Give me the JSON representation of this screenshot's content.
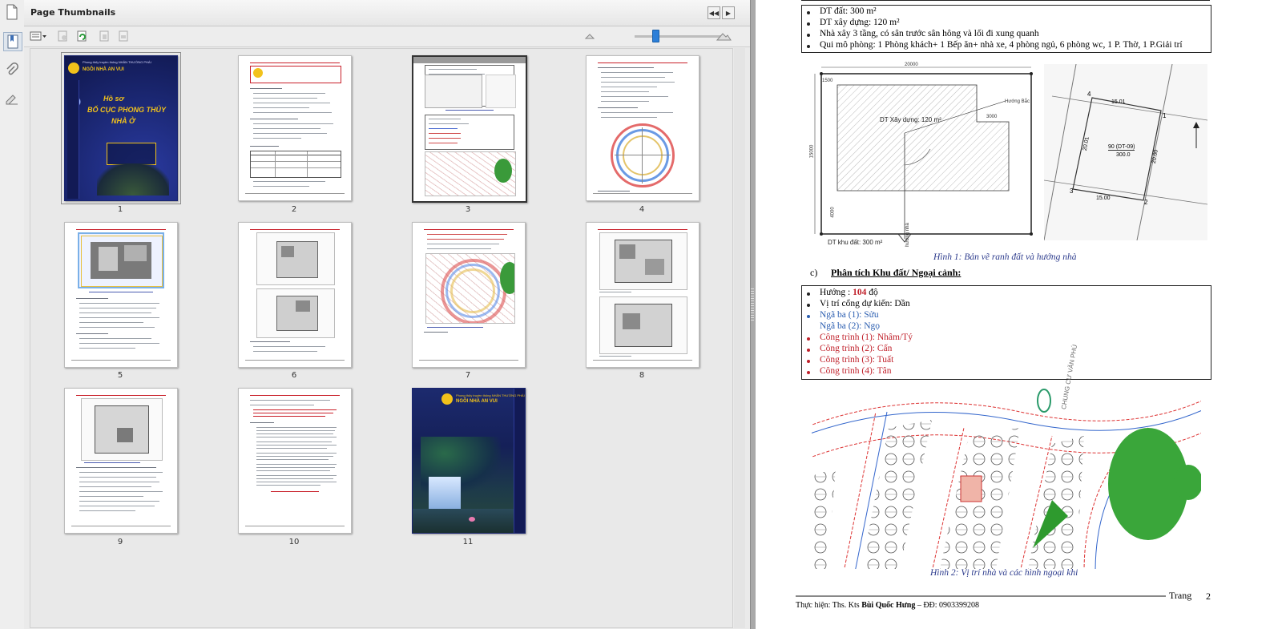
{
  "panel": {
    "title": "Page Thumbnails",
    "pages": [
      "1",
      "2",
      "3",
      "4",
      "5",
      "6",
      "7",
      "8",
      "9",
      "10",
      "11"
    ]
  },
  "cover": {
    "tag": "Phong thủy truyền thống NHÂN THƯỜNG PHÁI",
    "brand": "NGÔI NHÀ AN VUI",
    "heading_top": "Hồ sơ",
    "heading_mid": "BỐ CỤC PHONG THỦY",
    "heading_bot": "NHÀ Ở"
  },
  "document": {
    "info_items": [
      "DT đất: 300 m²",
      "DT xây dựng: 120 m²",
      "Nhà xây 3 tầng, có sân trước sân hông và lối đi xung quanh",
      "Qui mô phòng: 1 Phòng khách+ 1 Bếp ăn+ nhà xe, 4 phòng ngủ, 6 phòng wc, 1 P. Thờ, 1 P.Giải trí"
    ],
    "plan": {
      "dim_top": "20000",
      "dim_left": "15000",
      "dim_small": "1500",
      "dim_right": "3000",
      "dim_bottom": "4000",
      "label_build": "DT Xây dựng: 120 m²",
      "label_land": "DT khu đất: 300 m²",
      "label_north": "Hướng Bắc",
      "label_dir": "hướng nhà"
    },
    "cadastral": {
      "parcel": "90 (DT-09)",
      "area": "300.0",
      "p1": "1",
      "p2": "2",
      "p3": "3",
      "p4": "4",
      "d_top": "15.01",
      "d_bottom": "15.00",
      "d_left": "20.01",
      "d_right": "20.00"
    },
    "caption1": "Hình 1: Bản vẽ ranh đất và hướng nhà",
    "section_letter": "c)",
    "section_title": "Phân tích Khu đất/ Ngoại cảnh:",
    "analysis": {
      "direction_prefix": "Hướng : ",
      "direction_value": "104",
      "direction_suffix": " độ",
      "gate": "Vị trí cổng dự kiến: Dần",
      "junction1": "Ngã ba (1): Sửu",
      "junction2": "Ngã ba (2): Ngọ",
      "buildings": [
        "Công trình (1): Nhâm/Tý",
        "Công trình (2): Cấn",
        "Công trình (3): Tuất",
        "Công trình (4): Tân"
      ]
    },
    "map_label": "CHUNG CƯ VĂN PHÚ",
    "caption2": "Hình 2: Vị trí nhà và các hình ngoại khi",
    "footer_left": "Thực hiện: Ths. Kts ",
    "footer_name": "Bùi Quốc Hưng",
    "footer_right": " – ĐĐ: 0903399208",
    "footer_trang": "Trang",
    "footer_page": "2"
  },
  "colors": {
    "accent_blue": "#2d7fd8",
    "text_red": "#c0202a",
    "text_blue": "#2a5db0",
    "cover_navy": "#1a2670",
    "cover_gold": "#f2c21b"
  }
}
